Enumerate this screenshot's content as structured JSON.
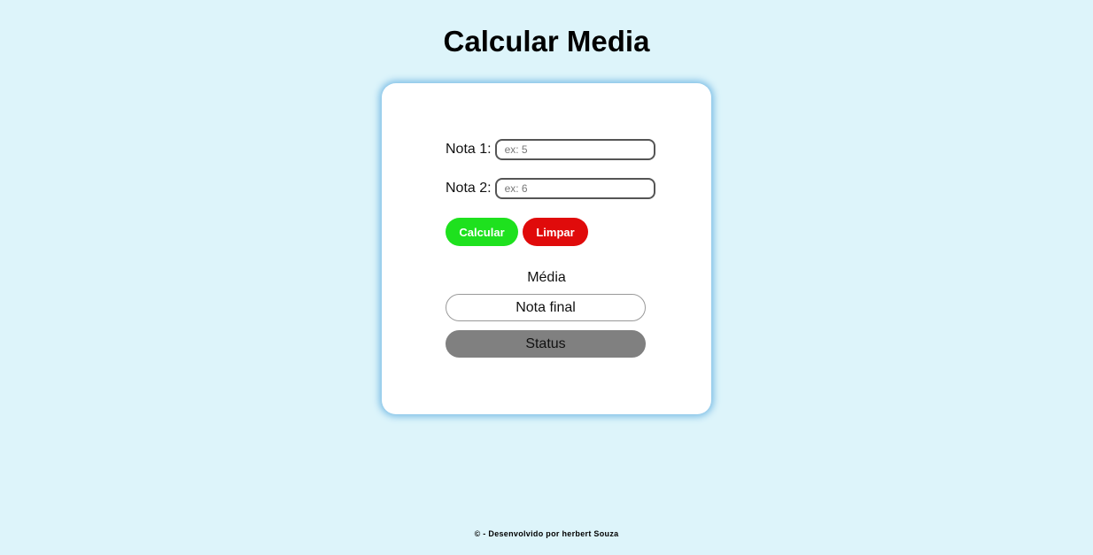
{
  "header": {
    "title": "Calcular Media"
  },
  "form": {
    "nota1_label": "Nota 1:",
    "nota1_placeholder": "ex: 5",
    "nota1_value": "",
    "nota2_label": "Nota 2:",
    "nota2_placeholder": "ex: 6",
    "nota2_value": "",
    "calcular_label": "Calcular",
    "limpar_label": "Limpar"
  },
  "result": {
    "media_label": "Média",
    "nota_final": "Nota final",
    "status": "Status"
  },
  "footer": {
    "text": "© - Desenvolvido por herbert Souza"
  },
  "colors": {
    "background": "#ddf4fa",
    "calcular": "#1ee11e",
    "limpar": "#e00b0b",
    "status": "#808080"
  }
}
